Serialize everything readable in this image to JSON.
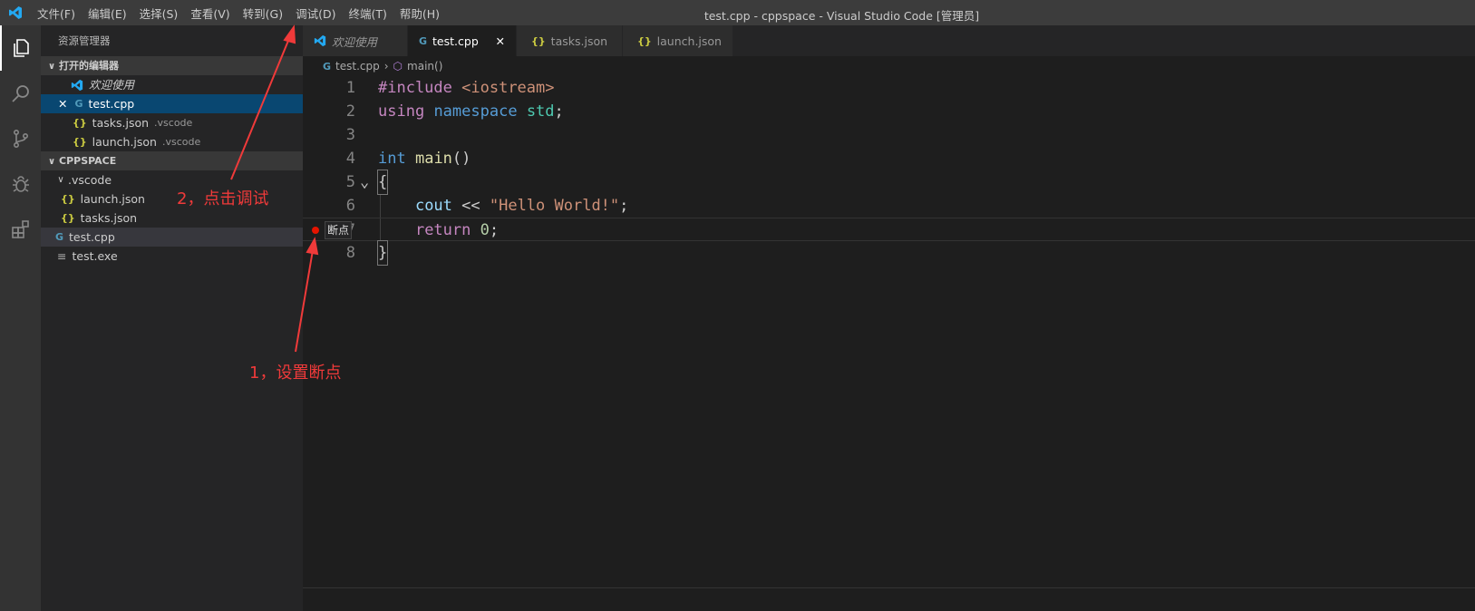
{
  "window": {
    "title": "test.cpp - cppspace - Visual Studio Code [管理员]"
  },
  "menu": [
    "文件(F)",
    "编辑(E)",
    "选择(S)",
    "查看(V)",
    "转到(G)",
    "调试(D)",
    "终端(T)",
    "帮助(H)"
  ],
  "sidebar": {
    "title": "资源管理器",
    "open_editors": {
      "label": "打开的编辑器",
      "items": [
        {
          "name": "欢迎使用",
          "desc": ""
        },
        {
          "name": "test.cpp",
          "desc": ""
        },
        {
          "name": "tasks.json",
          "desc": ".vscode"
        },
        {
          "name": "launch.json",
          "desc": ".vscode"
        }
      ]
    },
    "workspace": {
      "label": "CPPSPACE",
      "folder": ".vscode",
      "folder_items": [
        "launch.json",
        "tasks.json"
      ],
      "files": [
        "test.cpp",
        "test.exe"
      ]
    }
  },
  "tabs": [
    "欢迎使用",
    "test.cpp",
    "tasks.json",
    "launch.json"
  ],
  "breadcrumb": [
    "test.cpp",
    "main()"
  ],
  "code": {
    "lines": [
      "1",
      "2",
      "3",
      "4",
      "5",
      "6",
      "7",
      "8"
    ],
    "breakpoint_line": 7,
    "breakpoint_tooltip": "断点"
  },
  "annotations": {
    "step2": "2，点击调试",
    "step1": "1，设置断点"
  },
  "colors": {
    "annotation": "#f03a3a",
    "selection": "#094771",
    "breakpoint": "#e51400"
  }
}
